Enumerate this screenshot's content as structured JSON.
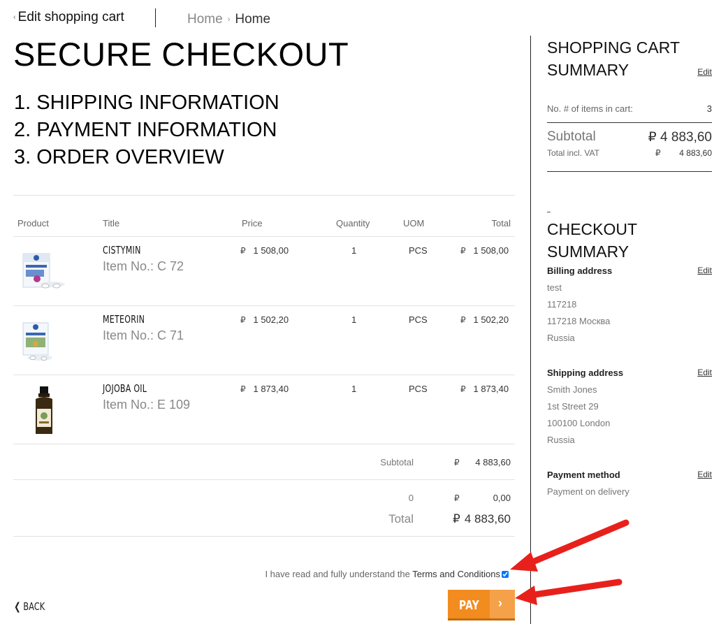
{
  "nav": {
    "back_label": "Edit shopping cart",
    "crumb_1": "Home",
    "crumb_2": "Home"
  },
  "page_title": "SECURE CHECKOUT",
  "steps": [
    "1. SHIPPING INFORMATION",
    "2. PAYMENT INFORMATION",
    "3. ORDER OVERVIEW"
  ],
  "table": {
    "headers": [
      "Product",
      "Title",
      "Price",
      "Quantity",
      "UOM",
      "Total"
    ],
    "currency": "₽",
    "rows": [
      {
        "title": "CISTYMIN",
        "item_no": "Item No.: C 72",
        "price": "1 508,00",
        "qty": "1",
        "uom": "PCS",
        "total": "1 508,00"
      },
      {
        "title": "METEORIN",
        "item_no": "Item No.: C 71",
        "price": "1 502,20",
        "qty": "1",
        "uom": "PCS",
        "total": "1 502,20"
      },
      {
        "title": "JOJOBA OIL",
        "item_no": "Item No.: E 109",
        "price": "1 873,40",
        "qty": "1",
        "uom": "PCS",
        "total": "1 873,40"
      }
    ],
    "subtotal_label": "Subtotal",
    "subtotal_value": "4 883,60",
    "extra_label": "0",
    "extra_value": "0,00",
    "total_label": "Total",
    "total_value": "4 883,60"
  },
  "terms": {
    "text": "I have read and fully understand the",
    "link": "Terms and Conditions",
    "checked": true
  },
  "footer": {
    "back_label": "BACK",
    "pay_label": "PAY"
  },
  "cart_summary": {
    "title_line1": "SHOPPING CART",
    "title_line2": "SUMMARY",
    "edit_label": "Edit",
    "items_label": "No. # of items in cart:",
    "items_value": "3",
    "subtotal_label": "Subtotal",
    "subtotal_value": "₽ 4 883,60",
    "vat_label": "Total incl. VAT",
    "vat_currency": "₽",
    "vat_value": "4 883,60"
  },
  "checkout_summary": {
    "title_line1": "CHECKOUT",
    "title_line2": "SUMMARY",
    "billing_label": "Billing address",
    "billing_lines": [
      "test",
      "117218",
      "117218 Москва",
      "Russia"
    ],
    "shipping_label": "Shipping address",
    "shipping_lines": [
      "Smith Jones",
      "1st Street 29",
      "100100 London",
      "Russia"
    ],
    "payment_label": "Payment method",
    "payment_value": "Payment on delivery",
    "edit_label": "Edit"
  },
  "colors": {
    "pay_button": "#f28c1f",
    "annotation_arrow": "#e8201c"
  }
}
